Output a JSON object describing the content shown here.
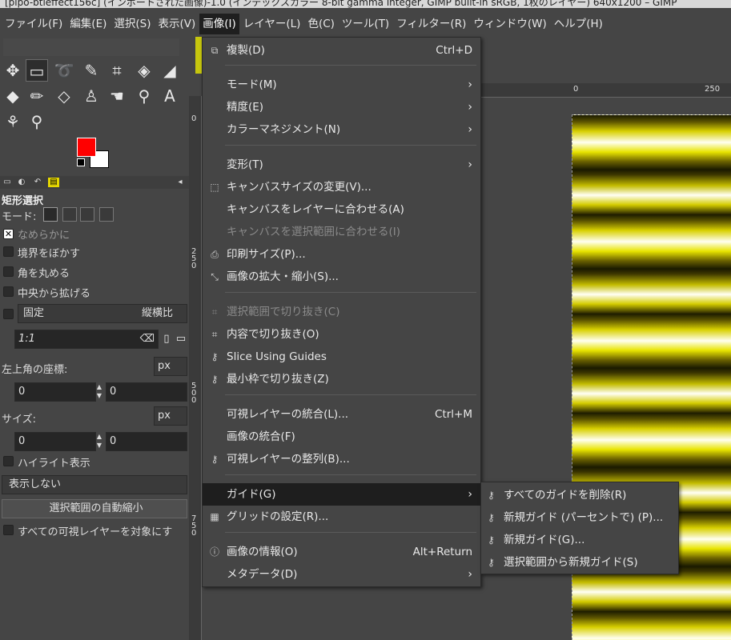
{
  "window": {
    "title": "[pipo-btleffect156c] (インポートされた画像)-1.0 (インデックスカラー 8-bit gamma integer, GIMP built-in sRGB, 1枚のレイヤー) 640x1200 – GIMP"
  },
  "menubar": [
    "ファイル(F)",
    "編集(E)",
    "選択(S)",
    "表示(V)",
    "画像(I)",
    "レイヤー(L)",
    "色(C)",
    "ツール(T)",
    "フィルター(R)",
    "ウィンドウ(W)",
    "ヘルプ(H)"
  ],
  "colors": {
    "foreground": "#ff0000",
    "background": "#ffffff"
  },
  "tool_options": {
    "title": "矩形選択",
    "mode_label": "モード:",
    "antialias": "なめらかに",
    "feather": "境界をぼかす",
    "rounded": "角を丸める",
    "expand_center": "中央から拡げる",
    "fixed_label": "固定",
    "fixed_value": "縦横比",
    "ratio_value": "1:1",
    "position_label": "左上角の座標:",
    "position_unit": "px",
    "position_x": "0",
    "position_y": "0",
    "size_label": "サイズ:",
    "size_unit": "px",
    "size_w": "0",
    "size_h": "0",
    "highlight": "ハイライト表示",
    "guides_value": "表示しない",
    "auto_shrink": "選択範囲の自動縮小",
    "all_layers": "すべての可視レイヤーを対象にす"
  },
  "rulers": {
    "top": [
      "0",
      "250"
    ],
    "left": [
      "0",
      "250",
      "500",
      "750"
    ]
  },
  "image_menu": [
    {
      "label": "複製(D)",
      "shortcut": "Ctrl+D",
      "icon": "duplicate-icon"
    },
    {
      "label": "モード(M)",
      "submenu": true
    },
    {
      "label": "精度(E)",
      "submenu": true
    },
    {
      "label": "カラーマネジメント(N)",
      "submenu": true
    },
    {
      "label": "変形(T)",
      "submenu": true
    },
    {
      "label": "キャンバスサイズの変更(V)...",
      "icon": "canvas-size-icon"
    },
    {
      "label": "キャンバスをレイヤーに合わせる(A)"
    },
    {
      "label": "キャンバスを選択範囲に合わせる(I)",
      "disabled": true
    },
    {
      "label": "印刷サイズ(P)...",
      "icon": "print-icon"
    },
    {
      "label": "画像の拡大・縮小(S)...",
      "icon": "scale-icon"
    },
    {
      "label": "選択範囲で切り抜き(C)",
      "disabled": true,
      "icon": "crop-icon"
    },
    {
      "label": "内容で切り抜き(O)",
      "icon": "crop-icon"
    },
    {
      "label": "Slice Using Guides",
      "icon": "guide-icon"
    },
    {
      "label": "最小枠で切り抜き(Z)",
      "icon": "guide-icon"
    },
    {
      "label": "可視レイヤーの統合(L)...",
      "shortcut": "Ctrl+M"
    },
    {
      "label": "画像の統合(F)"
    },
    {
      "label": "可視レイヤーの整列(B)...",
      "icon": "guide-icon"
    },
    {
      "label": "ガイド(G)",
      "submenu": true,
      "highlighted": true
    },
    {
      "label": "グリッドの設定(R)...",
      "icon": "grid-icon"
    },
    {
      "label": "画像の情報(O)",
      "shortcut": "Alt+Return",
      "icon": "info-icon"
    },
    {
      "label": "メタデータ(D)",
      "submenu": true
    }
  ],
  "guides_submenu": [
    {
      "label": "すべてのガイドを削除(R)",
      "icon": "guide-icon"
    },
    {
      "label": "新規ガイド (パーセントで) (P)...",
      "icon": "guide-icon"
    },
    {
      "label": "新規ガイド(G)...",
      "icon": "guide-icon"
    },
    {
      "label": "選択範囲から新規ガイド(S)",
      "icon": "guide-icon"
    }
  ]
}
